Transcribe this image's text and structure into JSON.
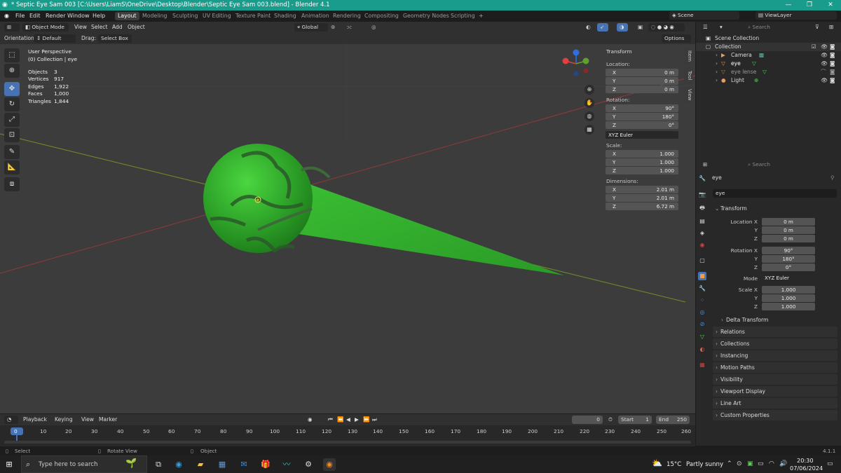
{
  "window": {
    "title": "* Septic Eye Sam 003 [C:\\Users\\LiamS\\OneDrive\\Desktop\\Blender\\Septic Eye Sam 003.blend] - Blender 4.1"
  },
  "menu": [
    "File",
    "Edit",
    "Render",
    "Window",
    "Help"
  ],
  "workspaces": [
    "Layout",
    "Modeling",
    "Sculpting",
    "UV Editing",
    "Texture Paint",
    "Shading",
    "Animation",
    "Rendering",
    "Compositing",
    "Geometry Nodes",
    "Scripting"
  ],
  "scene": {
    "label": "Scene",
    "view_layer": "ViewLayer"
  },
  "viewport_header": {
    "mode": "Object Mode",
    "menus": [
      "View",
      "Select",
      "Add",
      "Object"
    ],
    "orientation_transform": "Global",
    "orientation_label": "Orientation:",
    "orientation_value": "Default",
    "drag_label": "Drag:",
    "drag_value": "Select Box",
    "options": "Options"
  },
  "overlay_stats": {
    "perspective": "User Perspective",
    "collection": "(0) Collection | eye",
    "rows": [
      {
        "label": "Objects",
        "value": "3"
      },
      {
        "label": "Vertices",
        "value": "917"
      },
      {
        "label": "Edges",
        "value": "1,922"
      },
      {
        "label": "Faces",
        "value": "1,000"
      },
      {
        "label": "Triangles",
        "value": "1,844"
      }
    ]
  },
  "npanel": {
    "header": "Transform",
    "location_label": "Location:",
    "location": [
      {
        "axis": "X",
        "value": "0 m"
      },
      {
        "axis": "Y",
        "value": "0 m"
      },
      {
        "axis": "Z",
        "value": "0 m"
      }
    ],
    "rotation_label": "Rotation:",
    "rotation": [
      {
        "axis": "X",
        "value": "90°"
      },
      {
        "axis": "Y",
        "value": "180°"
      },
      {
        "axis": "Z",
        "value": "0°"
      }
    ],
    "rotation_mode": "XYZ Euler",
    "scale_label": "Scale:",
    "scale": [
      {
        "axis": "X",
        "value": "1.000"
      },
      {
        "axis": "Y",
        "value": "1.000"
      },
      {
        "axis": "Z",
        "value": "1.000"
      }
    ],
    "dimensions_label": "Dimensions:",
    "dimensions": [
      {
        "axis": "X",
        "value": "2.01 m"
      },
      {
        "axis": "Y",
        "value": "2.01 m"
      },
      {
        "axis": "Z",
        "value": "6.72 m"
      }
    ],
    "tabs": [
      "Item",
      "Tool",
      "View"
    ]
  },
  "outliner": {
    "search_placeholder": "Search",
    "items": [
      {
        "label": "Scene Collection"
      },
      {
        "label": "Collection"
      },
      {
        "label": "Camera"
      },
      {
        "label": "eye"
      },
      {
        "label": "eye lense"
      },
      {
        "label": "Light"
      }
    ]
  },
  "properties": {
    "search_placeholder": "Search",
    "object_name": "eye",
    "object_field": "eye",
    "transform_header": "Transform",
    "location_labels": [
      "Location X",
      "Y",
      "Z"
    ],
    "location_values": [
      "0 m",
      "0 m",
      "0 m"
    ],
    "rotation_labels": [
      "Rotation X",
      "Y",
      "Z"
    ],
    "rotation_values": [
      "90°",
      "180°",
      "0°"
    ],
    "mode_label": "Mode",
    "mode_value": "XYZ Euler",
    "scale_labels": [
      "Scale X",
      "Y",
      "Z"
    ],
    "scale_values": [
      "1.000",
      "1.000",
      "1.000"
    ],
    "delta": "Delta Transform",
    "sections": [
      "Relations",
      "Collections",
      "Instancing",
      "Motion Paths",
      "Visibility",
      "Viewport Display",
      "Line Art",
      "Custom Properties"
    ]
  },
  "timeline": {
    "menus": [
      "Playback",
      "Keying",
      "View",
      "Marker"
    ],
    "current_frame": "0",
    "start_label": "Start",
    "start": "1",
    "end_label": "End",
    "end": "250",
    "ticks": [
      "0",
      "10",
      "20",
      "30",
      "40",
      "50",
      "60",
      "70",
      "80",
      "90",
      "100",
      "110",
      "120",
      "130",
      "140",
      "150",
      "160",
      "170",
      "180",
      "190",
      "200",
      "210",
      "220",
      "230",
      "240",
      "250",
      "260"
    ]
  },
  "statusbar": {
    "items": [
      "Select",
      "Rotate View",
      "Object"
    ],
    "version": "4.1.1"
  },
  "taskbar": {
    "search_placeholder": "Type here to search",
    "weather_temp": "15°C",
    "weather_text": "Partly sunny",
    "time": "20:30",
    "date": "07/06/2024"
  },
  "colors": {
    "accent": "#4772b3",
    "titlebar": "#1a9c8c",
    "object": "#2fa42a"
  }
}
